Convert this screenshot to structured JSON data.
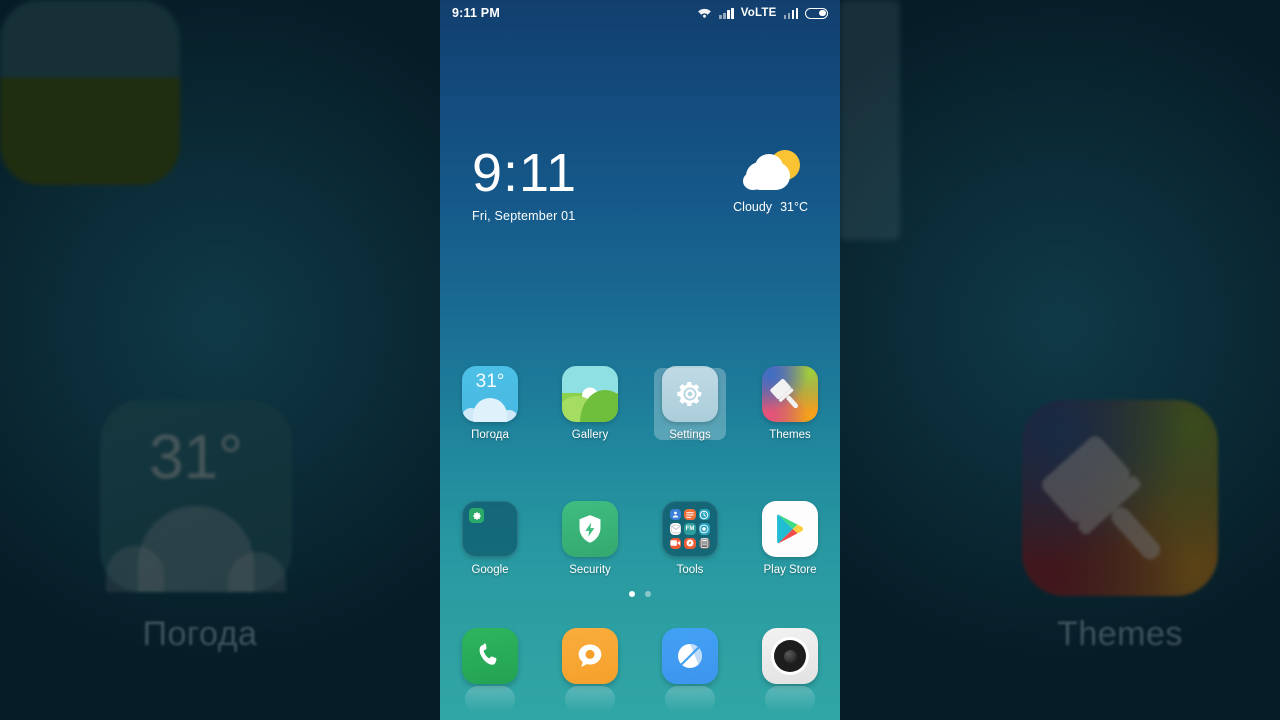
{
  "statusbar": {
    "time": "9:11 PM",
    "wifi_icon": "wifi-icon",
    "signal_icon": "signal-bars-icon",
    "volte": "VoLTE",
    "signal2_icon": "signal-bars-icon",
    "battery_icon": "battery-icon"
  },
  "clock_widget": {
    "time": "9:11",
    "date": "Fri, September 01",
    "weather_icon": "sun-behind-cloud-icon",
    "condition": "Cloudy",
    "temperature": "31°C"
  },
  "home": {
    "rows": [
      [
        {
          "label": "Погода",
          "icon": "weather-icon",
          "badge": "31°",
          "selected": false
        },
        {
          "label": "Gallery",
          "icon": "gallery-icon",
          "selected": false
        },
        {
          "label": "Settings",
          "icon": "gear-icon",
          "selected": true
        },
        {
          "label": "Themes",
          "icon": "paintbrush-icon",
          "selected": false
        }
      ],
      [
        {
          "label": "Google",
          "icon": "google-folder-icon",
          "selected": false
        },
        {
          "label": "Security",
          "icon": "shield-icon",
          "selected": false
        },
        {
          "label": "Tools",
          "icon": "tools-folder-icon",
          "selected": false
        },
        {
          "label": "Play Store",
          "icon": "play-store-icon",
          "selected": false
        }
      ]
    ],
    "page_dots": {
      "count": 2,
      "active": 0
    }
  },
  "dock": [
    {
      "label": "Phone",
      "icon": "phone-icon"
    },
    {
      "label": "Messaging",
      "icon": "message-icon"
    },
    {
      "label": "Browser",
      "icon": "compass-icon"
    },
    {
      "label": "Camera",
      "icon": "camera-icon"
    }
  ],
  "backdrop": {
    "left_label": "Погода",
    "left_badge": "31°",
    "right_label": "Themes"
  },
  "colors": {
    "wallpaper_top": "#123f6e",
    "wallpaper_bottom": "#31a6a6",
    "accent_sun": "#f9c334",
    "security_green": "#34a96f",
    "dock_phone_green": "#2eb45e",
    "dock_msg_orange": "#f6a02c",
    "dock_browser_blue": "#3d95ee"
  }
}
